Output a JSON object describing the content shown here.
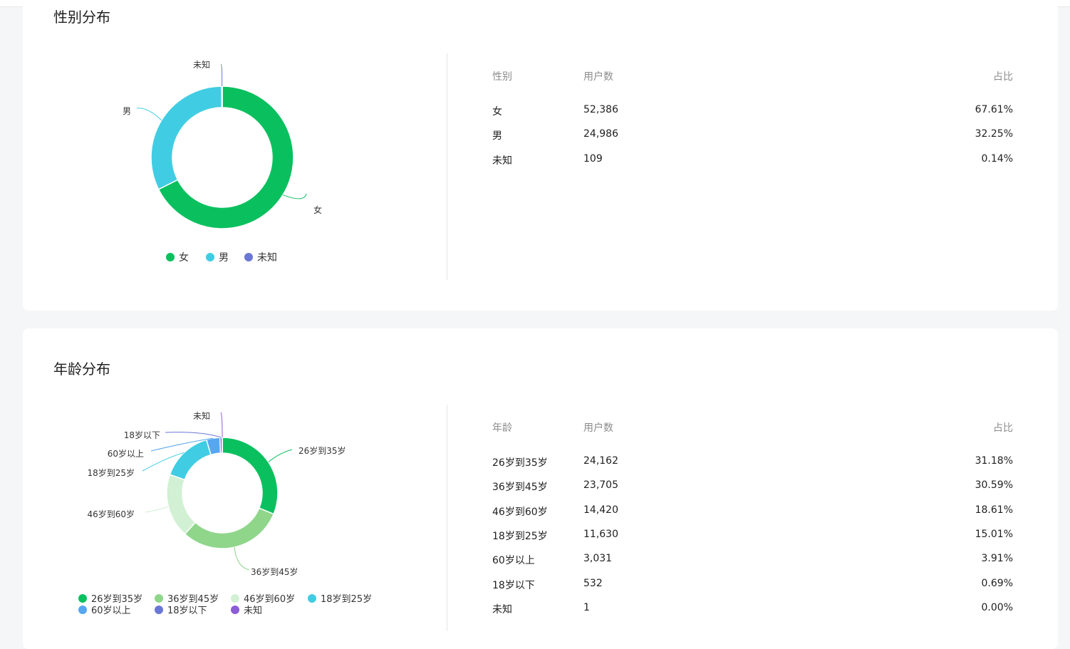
{
  "gender": {
    "title": "性别分布",
    "chart_data": {
      "type": "pie",
      "categories": [
        "女",
        "男",
        "未知"
      ],
      "values": [
        52386,
        24986,
        109
      ],
      "colors": [
        "#0ac05e",
        "#40cde3",
        "#6a77d4"
      ],
      "legend_position": "bottom"
    },
    "table": {
      "headers": [
        "性别",
        "用户数",
        "占比"
      ],
      "rows": [
        [
          "女",
          "52,386",
          "67.61%"
        ],
        [
          "男",
          "24,986",
          "32.25%"
        ],
        [
          "未知",
          "109",
          "0.14%"
        ]
      ]
    }
  },
  "age": {
    "title": "年龄分布",
    "chart_data": {
      "type": "pie",
      "categories": [
        "26岁到35岁",
        "36岁到45岁",
        "46岁到60岁",
        "18岁到25岁",
        "60岁以上",
        "18岁以下",
        "未知"
      ],
      "values": [
        24162,
        23705,
        14420,
        11630,
        3031,
        532,
        1
      ],
      "colors": [
        "#0ac05e",
        "#8fd68b",
        "#d2f0d4",
        "#40cde3",
        "#56a6f0",
        "#6a77d4",
        "#8b5cd6"
      ],
      "legend_position": "bottom"
    },
    "table": {
      "headers": [
        "年龄",
        "用户数",
        "占比"
      ],
      "rows": [
        [
          "26岁到35岁",
          "24,162",
          "31.18%"
        ],
        [
          "36岁到45岁",
          "23,705",
          "30.59%"
        ],
        [
          "46岁到60岁",
          "14,420",
          "18.61%"
        ],
        [
          "18岁到25岁",
          "11,630",
          "15.01%"
        ],
        [
          "60岁以上",
          "3,031",
          "3.91%"
        ],
        [
          "18岁以下",
          "532",
          "0.69%"
        ],
        [
          "未知",
          "1",
          "0.00%"
        ]
      ]
    }
  }
}
